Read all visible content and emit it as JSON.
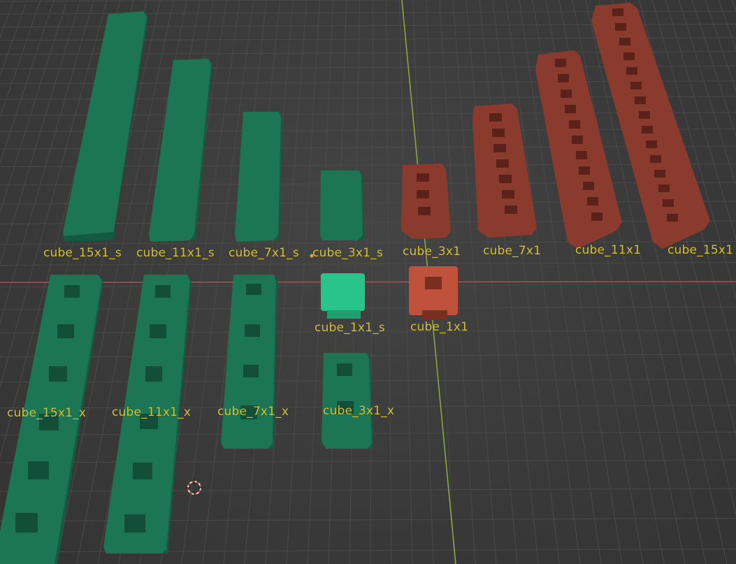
{
  "viewport": {
    "background": "#3a3a3a",
    "grid_color": "#4a4a4a",
    "x_axis_color": "#b94a4e",
    "y_axis_color": "#8cae3c",
    "label_color": "#d4c232",
    "green_object_color": "#1f7a5a",
    "green_selected_color": "#28c48c",
    "red_object_color": "#8c3c2e",
    "red_active_color": "#c0523c"
  },
  "objects": [
    {
      "name": "cube_15x1_s",
      "group": "green"
    },
    {
      "name": "cube_11x1_s",
      "group": "green"
    },
    {
      "name": "cube_7x1_s",
      "group": "green"
    },
    {
      "name": "cube_3x1_s",
      "group": "green"
    },
    {
      "name": "cube_3x1",
      "group": "red"
    },
    {
      "name": "cube_7x1",
      "group": "red"
    },
    {
      "name": "cube_11x1",
      "group": "red"
    },
    {
      "name": "cube_15x1",
      "group": "red"
    },
    {
      "name": "cube_1x1_s",
      "group": "green",
      "selected": true
    },
    {
      "name": "cube_1x1",
      "group": "red",
      "active": true
    },
    {
      "name": "cube_15x1_x",
      "group": "green"
    },
    {
      "name": "cube_11x1_x",
      "group": "green"
    },
    {
      "name": "cube_7x1_x",
      "group": "green"
    },
    {
      "name": "cube_3x1_x",
      "group": "green"
    }
  ],
  "cursor": {
    "icon": "3d-cursor-icon"
  }
}
